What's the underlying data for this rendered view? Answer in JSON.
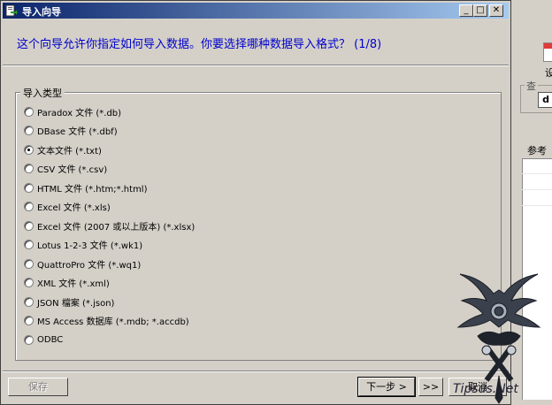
{
  "window": {
    "title": "导入向导",
    "controls": {
      "minimize": "_",
      "maximize": "□",
      "close": "✕"
    }
  },
  "question": "这个向导允许你指定如何导入数据。你要选择哪种数据导入格式？  (1/8)",
  "import_type": {
    "label": "导入类型",
    "options": [
      {
        "label": "Paradox 文件 (*.db)",
        "selected": false
      },
      {
        "label": "DBase 文件 (*.dbf)",
        "selected": false
      },
      {
        "label": "文本文件 (*.txt)",
        "selected": true
      },
      {
        "label": "CSV 文件 (*.csv)",
        "selected": false
      },
      {
        "label": "HTML 文件 (*.htm;*.html)",
        "selected": false
      },
      {
        "label": "Excel 文件 (*.xls)",
        "selected": false
      },
      {
        "label": "Excel 文件 (2007 或以上版本) (*.xlsx)",
        "selected": false
      },
      {
        "label": "Lotus 1-2-3 文件 (*.wk1)",
        "selected": false
      },
      {
        "label": "QuattroPro 文件 (*.wq1)",
        "selected": false
      },
      {
        "label": "XML 文件 (*.xml)",
        "selected": false
      },
      {
        "label": "JSON 檔案 (*.json)",
        "selected": false
      },
      {
        "label": "MS Access 数据库 (*.mdb; *.accdb)",
        "selected": false
      },
      {
        "label": "ODBC",
        "selected": false
      }
    ]
  },
  "buttons": {
    "save": "保存",
    "next": "下一步 >",
    "last": ">>",
    "cancel": "取消"
  },
  "background_app": {
    "char": "设",
    "group_label": "查",
    "box_letter": "d",
    "column_header": "参考"
  },
  "watermark": {
    "text": "Tipsus.Net"
  }
}
